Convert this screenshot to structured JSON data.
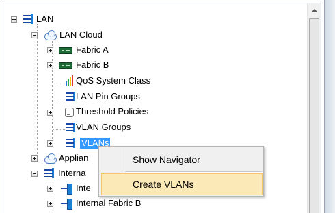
{
  "tree": {
    "lan": "LAN",
    "lan_cloud": "LAN Cloud",
    "fabric_a": "Fabric A",
    "fabric_b": "Fabric B",
    "qos": "QoS System Class",
    "lan_pin_groups": "LAN Pin Groups",
    "threshold_policies": "Threshold Policies",
    "vlan_groups": "VLAN Groups",
    "vlans": "VLANs",
    "appliances": "Applian",
    "internal": "Interna",
    "internal_fabric_a": "Inte",
    "internal_fabric_b": "Internal Fabric B"
  },
  "context_menu": {
    "show_navigator": "Show Navigator",
    "create_vlans": "Create VLANs"
  },
  "colors": {
    "selection": "#3399ff",
    "menu_hover": "#fbe9b8",
    "fabric_icon": "#1e6b38",
    "lan_icon": "#1a47a8"
  }
}
